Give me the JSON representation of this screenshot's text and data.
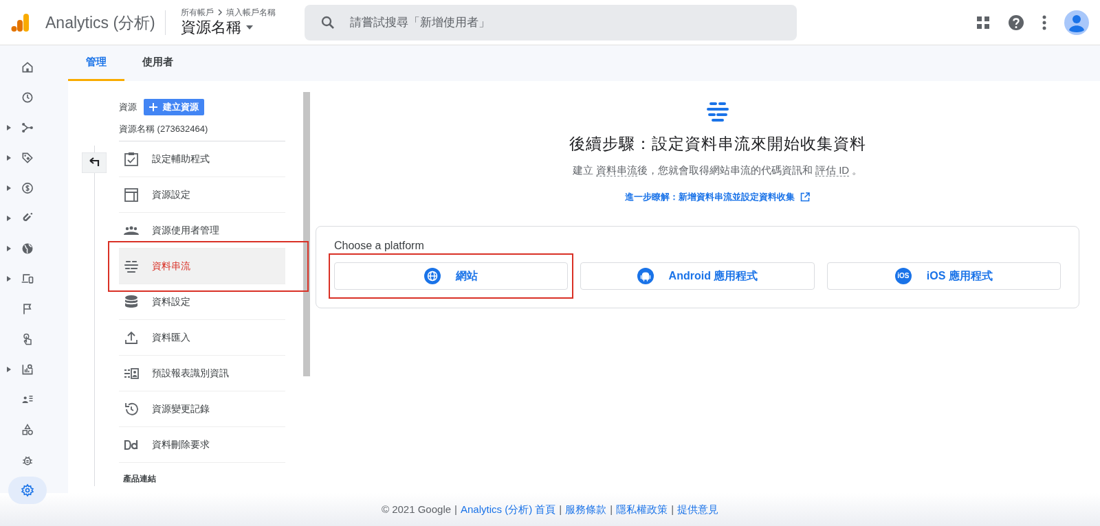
{
  "header": {
    "product": "Analytics (分析)",
    "breadcrumb": [
      "所有帳戶",
      "填入帳戶名稱"
    ],
    "property": "資源名稱",
    "search": {
      "placeholder": "請嘗試搜尋「新增使用者」"
    }
  },
  "rail": [
    {
      "kind": "home",
      "expandable": false,
      "selected": false
    },
    {
      "kind": "clock",
      "expandable": false,
      "selected": false
    },
    {
      "kind": "branch",
      "expandable": true,
      "selected": false
    },
    {
      "kind": "tag",
      "expandable": true,
      "selected": false
    },
    {
      "kind": "dollar",
      "expandable": true,
      "selected": false
    },
    {
      "kind": "magnet",
      "expandable": true,
      "selected": false
    },
    {
      "kind": "globe",
      "expandable": true,
      "selected": false
    },
    {
      "kind": "devices",
      "expandable": true,
      "selected": false
    },
    {
      "kind": "flag",
      "expandable": false,
      "selected": false
    },
    {
      "kind": "touch",
      "expandable": false,
      "selected": false
    },
    {
      "kind": "report",
      "expandable": true,
      "selected": false
    },
    {
      "kind": "audience",
      "expandable": false,
      "selected": false
    },
    {
      "kind": "shapes",
      "expandable": false,
      "selected": false
    },
    {
      "kind": "bug",
      "expandable": false,
      "selected": false
    },
    {
      "kind": "gear",
      "expandable": false,
      "selected": true
    }
  ],
  "tabs": [
    {
      "label": "管理",
      "selected": true
    },
    {
      "label": "使用者",
      "selected": false
    }
  ],
  "admin": {
    "section_label": "資源",
    "create_button": "建立資源",
    "property_name": "資源名稱 (273632464)",
    "items": [
      {
        "kind": "setup",
        "label": "設定輔助程式",
        "selected": false,
        "highlighted": false
      },
      {
        "kind": "layout",
        "label": "資源設定",
        "selected": false,
        "highlighted": false
      },
      {
        "kind": "people",
        "label": "資源使用者管理",
        "selected": false,
        "highlighted": false
      },
      {
        "kind": "streams",
        "label": "資料串流",
        "selected": true,
        "highlighted": true
      },
      {
        "kind": "database",
        "label": "資料設定",
        "selected": false,
        "highlighted": false
      },
      {
        "kind": "upload",
        "label": "資料匯入",
        "selected": false,
        "highlighted": false
      },
      {
        "kind": "identity",
        "label": "預設報表識別資訊",
        "selected": false,
        "highlighted": false
      },
      {
        "kind": "history",
        "label": "資源變更記錄",
        "selected": false,
        "highlighted": false
      },
      {
        "kind": "dd",
        "label": "資料刪除要求",
        "selected": false,
        "highlighted": false
      }
    ],
    "next_section": "產品連結"
  },
  "main": {
    "heading": "後續步驟：設定資料串流來開始收集資料",
    "subtitle": [
      {
        "kind": "text",
        "text": "建立 "
      },
      {
        "kind": "term",
        "text": "資料串流"
      },
      {
        "kind": "text",
        "text": "後，您就會取得網站串流的代碼資訊和 "
      },
      {
        "kind": "term",
        "text": "評估 ID"
      },
      {
        "kind": "text",
        "text": " 。"
      }
    ],
    "learn_more": "進一步瞭解：新增資料串流並設定資料收集",
    "platform_card": {
      "title": "Choose a platform",
      "options": [
        {
          "kind": "web",
          "label": "網站",
          "highlighted": true
        },
        {
          "kind": "android",
          "label": "Android 應用程式",
          "highlighted": false
        },
        {
          "kind": "ios",
          "label": "iOS 應用程式",
          "icon_text": "iOS",
          "highlighted": false
        }
      ]
    }
  },
  "footer": {
    "copyright": "© 2021 Google",
    "separator": "|",
    "links": [
      "Analytics (分析) 首頁",
      "服務條款",
      "隱私權政策",
      "提供意見"
    ]
  }
}
